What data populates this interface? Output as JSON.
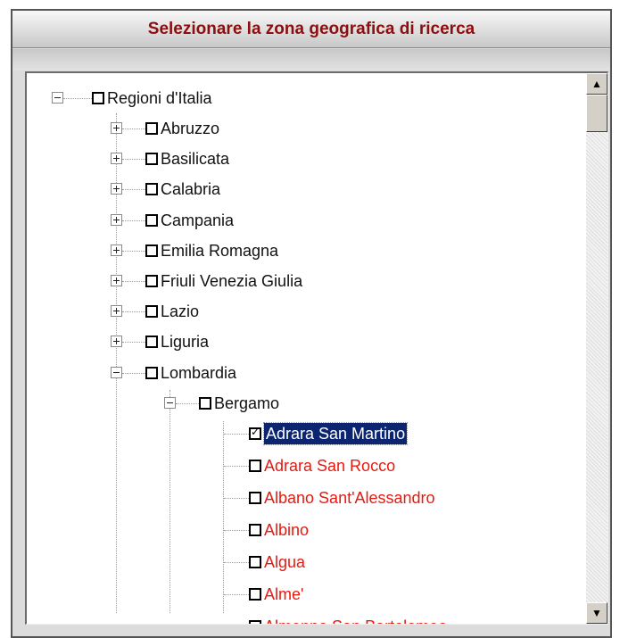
{
  "panel": {
    "title": "Selezionare la zona geografica di ricerca"
  },
  "tree": {
    "root": "Regioni d'Italia",
    "regions": [
      "Abruzzo",
      "Basilicata",
      "Calabria",
      "Campania",
      "Emilia Romagna",
      "Friuli Venezia Giulia",
      "Lazio",
      "Liguria"
    ],
    "expanded_region": "Lombardia",
    "province": "Bergamo",
    "comuni": [
      {
        "name": "Adrara San Martino",
        "checked": true,
        "selected": true
      },
      {
        "name": "Adrara San Rocco",
        "checked": false
      },
      {
        "name": "Albano Sant'Alessandro",
        "checked": false
      },
      {
        "name": "Albino",
        "checked": false
      },
      {
        "name": "Algua",
        "checked": false
      },
      {
        "name": "Alme'",
        "checked": false
      },
      {
        "name": "Almenno San Bartolomeo",
        "checked": false
      }
    ]
  },
  "scrollbar": {
    "up_icon": "triangle-up-icon",
    "down_icon": "triangle-down-icon"
  },
  "colors": {
    "title": "#8b0f0f",
    "comune_text": "#e8190f",
    "selection": "#0b2570"
  }
}
